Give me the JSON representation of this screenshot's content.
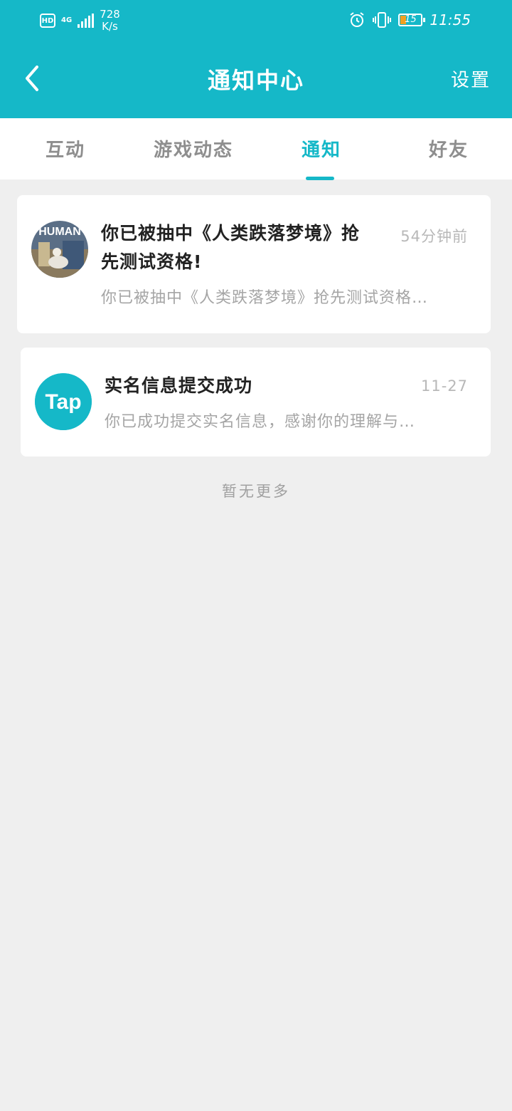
{
  "status_bar": {
    "hd": "HD",
    "network": "4G",
    "speed_value": "728",
    "speed_unit": "K/s",
    "battery": "15",
    "time": "11:55"
  },
  "header": {
    "title": "通知中心",
    "settings_label": "设置"
  },
  "tabs": [
    {
      "label": "互动"
    },
    {
      "label": "游戏动态"
    },
    {
      "label": "通知",
      "active": true
    },
    {
      "label": "好友"
    }
  ],
  "notifications": [
    {
      "title_line1": "你已被抽中《人类跌落梦境》抢",
      "title_line2": "先测试资格!",
      "time": "54分钟前",
      "body": "你已被抽中《人类跌落梦境》抢先测试资格…",
      "avatar_text": "HUMAN"
    },
    {
      "title_line1": "实名信息提交成功",
      "time": "11-27",
      "body": "你已成功提交实名信息，感谢你的理解与…",
      "avatar_text": "Tap"
    }
  ],
  "footer": {
    "no_more": "暂无更多"
  },
  "colors": {
    "accent": "#15b8c8",
    "background": "#efefef"
  }
}
